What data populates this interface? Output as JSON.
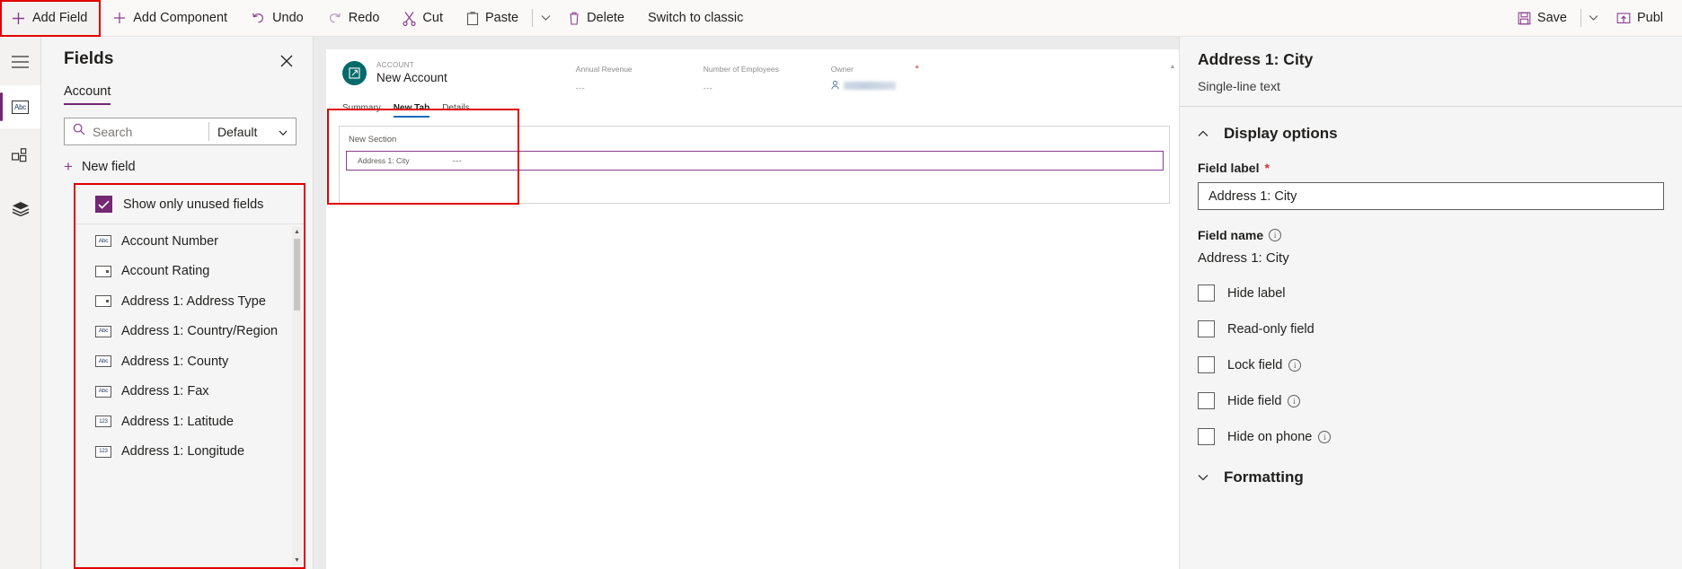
{
  "toolbar": {
    "add_field": "Add Field",
    "add_component": "Add Component",
    "undo": "Undo",
    "redo": "Redo",
    "cut": "Cut",
    "paste": "Paste",
    "delete": "Delete",
    "switch_to_classic": "Switch to classic",
    "save": "Save",
    "publish": "Publ"
  },
  "rail": {
    "items": [
      {
        "name": "menu-icon",
        "label": "Menu"
      },
      {
        "name": "fields-icon",
        "label": "Fields"
      },
      {
        "name": "components-icon",
        "label": "Components"
      },
      {
        "name": "layers-icon",
        "label": "Tree view"
      }
    ]
  },
  "fields_panel": {
    "title": "Fields",
    "close_label": "Close",
    "tab": "Account",
    "search_placeholder": "Search",
    "search_value": "",
    "filter_value": "Default",
    "new_field": "New field",
    "show_only_unused": "Show only unused fields",
    "show_only_unused_checked": true,
    "items": [
      {
        "label": "Account Number",
        "icon": "text-field-icon",
        "type": "text"
      },
      {
        "label": "Account Rating",
        "icon": "option-set-icon",
        "type": "optionset"
      },
      {
        "label": "Address 1: Address Type",
        "icon": "option-set-icon",
        "type": "optionset"
      },
      {
        "label": "Address 1: Country/Region",
        "icon": "text-field-icon",
        "type": "text"
      },
      {
        "label": "Address 1: County",
        "icon": "text-field-icon",
        "type": "text"
      },
      {
        "label": "Address 1: Fax",
        "icon": "text-field-icon",
        "type": "text"
      },
      {
        "label": "Address 1: Latitude",
        "icon": "number-field-icon",
        "type": "number"
      },
      {
        "label": "Address 1: Longitude",
        "icon": "number-field-icon",
        "type": "number"
      }
    ]
  },
  "form": {
    "entity_eyebrow": "ACCOUNT",
    "record_name": "New Account",
    "header_columns": [
      {
        "label": "Annual Revenue",
        "value": "---"
      },
      {
        "label": "Number of Employees",
        "value": "---"
      },
      {
        "label": "Owner",
        "value": ""
      }
    ],
    "tabs": [
      {
        "label": "Summary",
        "active": false
      },
      {
        "label": "New Tab",
        "active": true
      },
      {
        "label": "Details",
        "active": false
      }
    ],
    "section_title": "New Section",
    "field_label": "Address 1: City",
    "field_value": "---"
  },
  "properties": {
    "title": "Address 1: City",
    "subtitle": "Single-line text",
    "display_options": "Display options",
    "field_label_heading": "Field label",
    "field_label_required": "*",
    "field_label_value": "Address 1: City",
    "field_name_heading": "Field name",
    "field_name_value": "Address 1: City",
    "checkboxes": [
      {
        "label": "Hide label",
        "checked": false,
        "info": false
      },
      {
        "label": "Read-only field",
        "checked": false,
        "info": false
      },
      {
        "label": "Lock field",
        "checked": false,
        "info": true
      },
      {
        "label": "Hide field",
        "checked": false,
        "info": true
      },
      {
        "label": "Hide on phone",
        "checked": false,
        "info": true
      }
    ],
    "formatting": "Formatting"
  },
  "colors": {
    "accent_purple": "#742774",
    "icon_purple": "#8a3d8f",
    "highlight_red": "#e00000",
    "tab_blue": "#0f6cbd",
    "avatar_teal": "#046a6a"
  }
}
